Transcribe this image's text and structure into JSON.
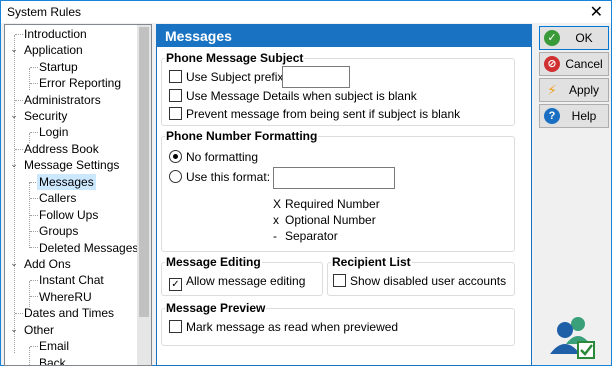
{
  "window": {
    "title": "System Rules",
    "close_glyph": "✕"
  },
  "tree": {
    "items": [
      {
        "label": "Introduction"
      },
      {
        "label": "Application"
      },
      {
        "label": "Startup"
      },
      {
        "label": "Error Reporting"
      },
      {
        "label": "Administrators"
      },
      {
        "label": "Security"
      },
      {
        "label": "Login"
      },
      {
        "label": "Address Book"
      },
      {
        "label": "Message Settings"
      },
      {
        "label": "Messages",
        "selected": true
      },
      {
        "label": "Callers"
      },
      {
        "label": "Follow Ups"
      },
      {
        "label": "Groups"
      },
      {
        "label": "Deleted Messages"
      },
      {
        "label": "Add Ons"
      },
      {
        "label": "Instant Chat"
      },
      {
        "label": "WhereRU"
      },
      {
        "label": "Dates and Times"
      },
      {
        "label": "Other"
      },
      {
        "label": "Email"
      },
      {
        "label": "Back..."
      }
    ],
    "expanded_glyph": "⌄"
  },
  "panel": {
    "title": "Messages",
    "subject": {
      "title": "Phone Message Subject",
      "use_prefix": "Use Subject prefix:",
      "prefix_value": "",
      "use_details": "Use Message Details when subject is blank",
      "prevent": "Prevent message from being sent if subject is blank"
    },
    "number_format": {
      "title": "Phone Number Formatting",
      "no_format": "No formatting",
      "use_format": "Use this format:",
      "format_value": "",
      "legend": [
        {
          "sym": "X",
          "text": "Required Number"
        },
        {
          "sym": "x",
          "text": "Optional Number"
        },
        {
          "sym": "-",
          "text": "Separator"
        }
      ]
    },
    "editing": {
      "title": "Message Editing",
      "allow": "Allow message editing",
      "allow_checked": true
    },
    "recipient": {
      "title": "Recipient List",
      "show_disabled": "Show disabled user accounts",
      "show_disabled_checked": false
    },
    "preview": {
      "title": "Message Preview",
      "mark_read": "Mark message as read when previewed",
      "mark_read_checked": false
    }
  },
  "buttons": {
    "ok": {
      "label": "OK",
      "icon": "check-circle-icon",
      "color": "#3a9a3a",
      "glyph": "✓"
    },
    "cancel": {
      "label": "Cancel",
      "icon": "no-entry-icon",
      "color": "#d03030",
      "glyph": "⊘"
    },
    "apply": {
      "label": "Apply",
      "icon": "lightning-icon",
      "color": "#f0a020",
      "glyph": "⚡"
    },
    "help": {
      "label": "Help",
      "icon": "question-circle-icon",
      "color": "#1a6fc2",
      "glyph": "?"
    }
  },
  "check_glyph": "✓",
  "colors": {
    "accent": "#1a73c2",
    "selection": "#cce8ff"
  }
}
